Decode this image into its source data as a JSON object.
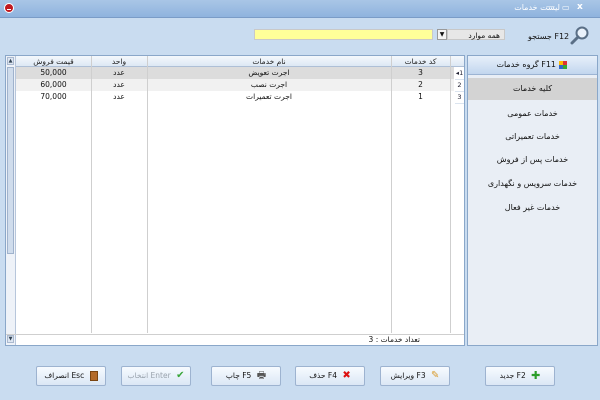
{
  "window": {
    "title": "لیست خدمات",
    "minimize": "—",
    "close": "x"
  },
  "search": {
    "label": "جستجو F12",
    "scope": "همه موارد",
    "value": ""
  },
  "grid": {
    "columns": {
      "code": "کد خدمات",
      "name": "نام خدمات",
      "unit": "واحد",
      "price": "قیمت فروش"
    },
    "rows": [
      {
        "num": "1",
        "code": "3",
        "name": "اجرت تعویض",
        "unit": "عدد",
        "price": "50,000"
      },
      {
        "num": "2",
        "code": "2",
        "name": "اجرت نصب",
        "unit": "عدد",
        "price": "60,000"
      },
      {
        "num": "3",
        "code": "1",
        "name": "اجرت تعمیرات",
        "unit": "عدد",
        "price": "70,000"
      }
    ],
    "count_label": "تعداد خدمات : 3"
  },
  "sidebar": {
    "header": "گروه خدمات F11",
    "items": [
      "کلیه خدمات",
      "خدمات عمومی",
      "خدمات تعمیراتی",
      "خدمات پس از فروش",
      "خدمات سرویس و نگهداری",
      "خدمات غیر فعال"
    ]
  },
  "buttons": {
    "new": "جدید F2",
    "edit": "ویرایش F3",
    "delete": "حذف F4",
    "print": "چاپ F5",
    "select": "انتخاب Enter",
    "cancel": "انصراف Esc"
  },
  "colors": {
    "search_bg": "#ffff99",
    "window_bg": "#c9dcf0",
    "accent": "#8fb3de"
  }
}
